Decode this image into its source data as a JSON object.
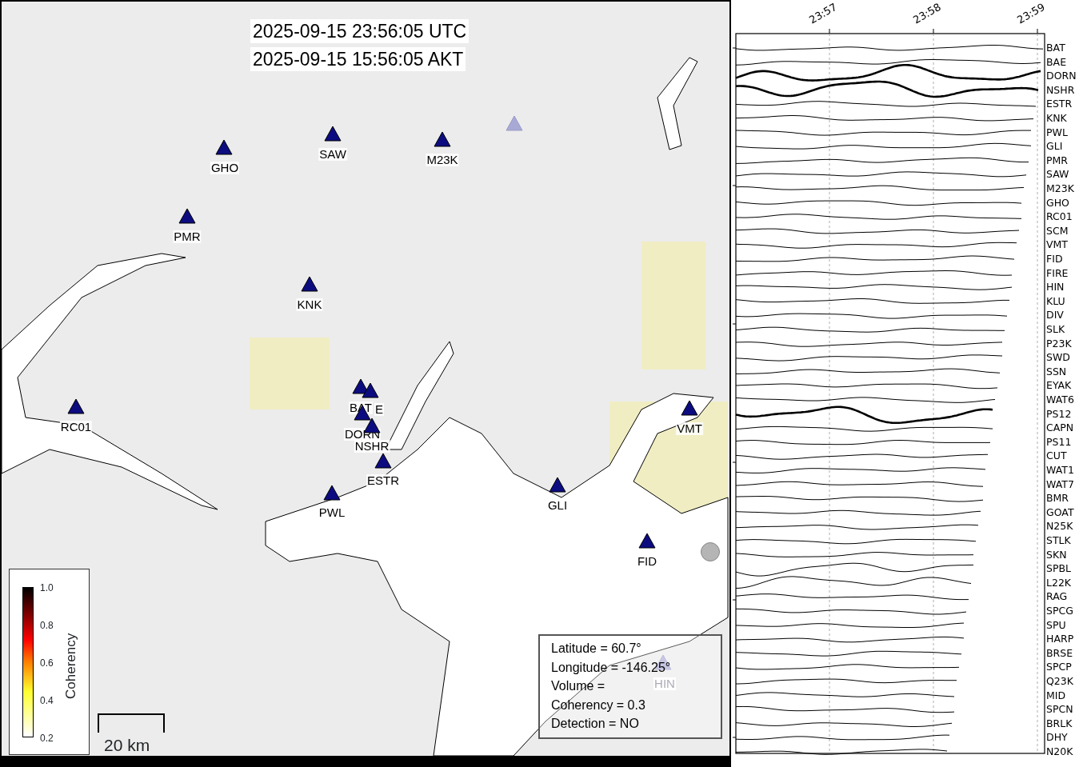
{
  "map": {
    "timestamps": [
      "2025-09-15 23:56:05 UTC",
      "2025-09-15 15:56:05 AKT"
    ],
    "markers": [
      {
        "kind": "station",
        "label": "GHO",
        "faded": false
      },
      {
        "kind": "station",
        "label": "SAW",
        "faded": false
      },
      {
        "kind": "station",
        "label": "M23K",
        "faded": false
      },
      {
        "kind": "station",
        "faded": true
      },
      {
        "kind": "station",
        "label": "PMR",
        "faded": false
      },
      {
        "kind": "station",
        "label": "KNK",
        "faded": false
      },
      {
        "kind": "station",
        "label": "BAT",
        "faded": false
      },
      {
        "kind": "station",
        "label": "E",
        "faded": false
      },
      {
        "kind": "station",
        "label": "DORN",
        "faded": false
      },
      {
        "kind": "station",
        "label": "NSHR",
        "faded": false
      },
      {
        "kind": "station",
        "label": "ESTR",
        "faded": false
      },
      {
        "kind": "station",
        "label": "PWL",
        "faded": false
      },
      {
        "kind": "station",
        "label": "GLI",
        "faded": false
      },
      {
        "kind": "station",
        "label": "VMT",
        "faded": false
      },
      {
        "kind": "station",
        "label": "FID",
        "faded": false
      },
      {
        "kind": "station",
        "label": "RC01",
        "faded": false
      },
      {
        "kind": "station",
        "label": "HIN",
        "faded": true
      },
      {
        "kind": "circle"
      }
    ],
    "colorbar": {
      "title": "Coherency",
      "ticks": [
        "1.0",
        "0.8",
        "0.6",
        "0.4",
        "0.2"
      ]
    },
    "scale_bar": "20 km",
    "info": [
      "Latitude = 60.7°",
      "Longitude = -146.25°",
      "Volume =",
      "Coherency = 0.3",
      "Detection = NO"
    ]
  },
  "traces": {
    "time_ticks": [
      "23:57",
      "23:58",
      "23:59"
    ],
    "stations": [
      {
        "label": "BAT",
        "emphasized": false
      },
      {
        "label": "BAE",
        "emphasized": false
      },
      {
        "label": "DORN",
        "emphasized": true
      },
      {
        "label": "NSHR",
        "emphasized": true
      },
      {
        "label": "ESTR",
        "emphasized": false
      },
      {
        "label": "KNK",
        "emphasized": false
      },
      {
        "label": "PWL",
        "emphasized": false
      },
      {
        "label": "GLI",
        "emphasized": false
      },
      {
        "label": "PMR",
        "emphasized": false
      },
      {
        "label": "SAW",
        "emphasized": false
      },
      {
        "label": "M23K",
        "emphasized": false
      },
      {
        "label": "GHO",
        "emphasized": false
      },
      {
        "label": "RC01",
        "emphasized": false
      },
      {
        "label": "SCM",
        "emphasized": false
      },
      {
        "label": "VMT",
        "emphasized": false
      },
      {
        "label": "FID",
        "emphasized": false
      },
      {
        "label": "FIRE",
        "emphasized": false
      },
      {
        "label": "HIN",
        "emphasized": false
      },
      {
        "label": "KLU",
        "emphasized": false
      },
      {
        "label": "DIV",
        "emphasized": false
      },
      {
        "label": "SLK",
        "emphasized": false
      },
      {
        "label": "P23K",
        "emphasized": false
      },
      {
        "label": "SWD",
        "emphasized": false
      },
      {
        "label": "SSN",
        "emphasized": false
      },
      {
        "label": "EYAK",
        "emphasized": false
      },
      {
        "label": "WAT6",
        "emphasized": false
      },
      {
        "label": "PS12",
        "emphasized": true
      },
      {
        "label": "CAPN",
        "emphasized": false
      },
      {
        "label": "PS11",
        "emphasized": false
      },
      {
        "label": "CUT",
        "emphasized": false
      },
      {
        "label": "WAT1",
        "emphasized": false
      },
      {
        "label": "WAT7",
        "emphasized": false
      },
      {
        "label": "BMR",
        "emphasized": false
      },
      {
        "label": "GOAT",
        "emphasized": false
      },
      {
        "label": "N25K",
        "emphasized": false
      },
      {
        "label": "STLK",
        "emphasized": false
      },
      {
        "label": "SKN",
        "emphasized": false
      },
      {
        "label": "SPBL",
        "emphasized": false
      },
      {
        "label": "L22K",
        "emphasized": false
      },
      {
        "label": "RAG",
        "emphasized": false
      },
      {
        "label": "SPCG",
        "emphasized": false
      },
      {
        "label": "SPU",
        "emphasized": false
      },
      {
        "label": "HARP",
        "emphasized": false
      },
      {
        "label": "BRSE",
        "emphasized": false
      },
      {
        "label": "SPCP",
        "emphasized": false
      },
      {
        "label": "Q23K",
        "emphasized": false
      },
      {
        "label": "MID",
        "emphasized": false
      },
      {
        "label": "SPCN",
        "emphasized": false
      },
      {
        "label": "BRLK",
        "emphasized": false
      },
      {
        "label": "DHY",
        "emphasized": false
      },
      {
        "label": "N20K",
        "emphasized": false
      }
    ]
  }
}
